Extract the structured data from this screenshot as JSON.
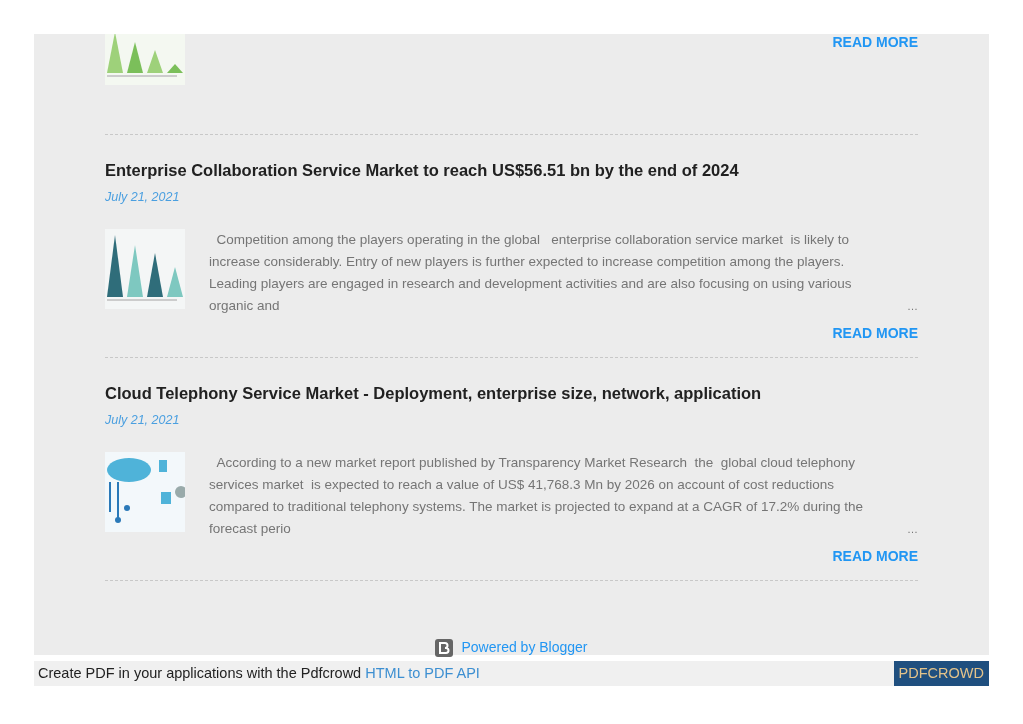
{
  "posts": [
    {
      "kind": "partial",
      "read_more": "READ MORE"
    },
    {
      "kind": "full",
      "title": "Enterprise Collaboration Service Market to reach US$56.51 bn by the end of 2024",
      "date": "July 21, 2021",
      "excerpt": "  Competition among the players operating in the global   enterprise collaboration service market  is likely to increase considerably. Entry of new players is further expected to increase competition among the players. Leading players are engaged in research and development activities and are also focusing on using various organic and",
      "ellipsis": "…",
      "read_more": "READ MORE"
    },
    {
      "kind": "full",
      "title": "Cloud Telephony Service Market - Deployment, enterprise size, network, application",
      "date": "July 21, 2021",
      "excerpt": "  According to a new market report published by Transparency Market Research  the  global cloud telephony services market  is expected to reach a value of US$ 41,768.3 Mn by 2026 on account of cost reductions compared to traditional telephony systems. The market is projected to expand at a CAGR of 17.2% during the forecast perio",
      "ellipsis": "…",
      "read_more": "READ MORE"
    }
  ],
  "footer": {
    "powered_by": "Powered by Blogger"
  },
  "pdf_bar": {
    "text": "Create PDF in your applications with the Pdfcrowd",
    "link": "HTML to PDF API",
    "badge": "PDFCROWD"
  }
}
